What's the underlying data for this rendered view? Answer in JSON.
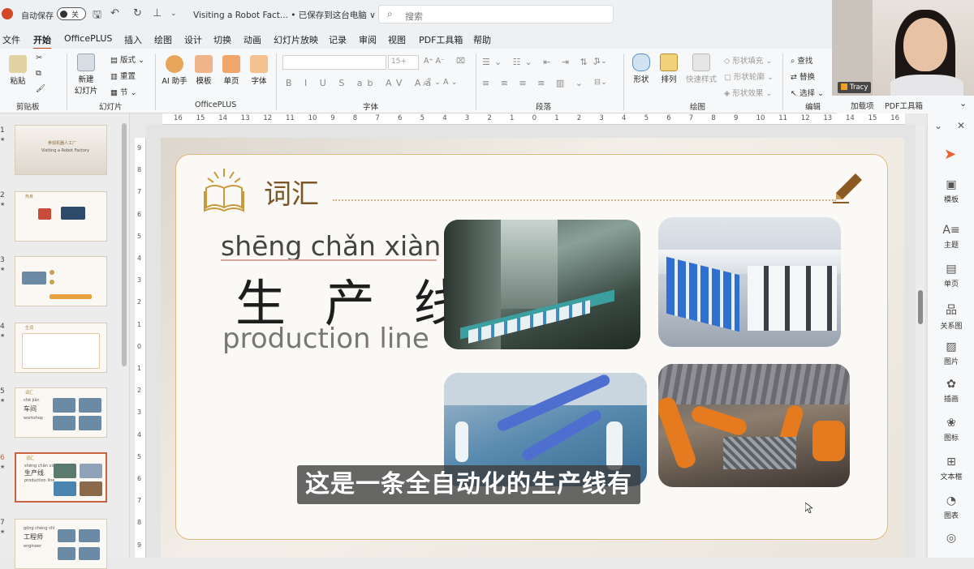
{
  "titlebar": {
    "autosave_label": "自动保存",
    "toggle_state": "关",
    "doc_title": "Visiting a Robot Fact... • 已保存到这台电脑 ∨",
    "search_placeholder": "搜索"
  },
  "menu": [
    "文件",
    "开始",
    "OfficePLUS",
    "插入",
    "绘图",
    "设计",
    "切换",
    "动画",
    "幻灯片放映",
    "记录",
    "审阅",
    "视图",
    "PDF工具箱",
    "帮助"
  ],
  "ribbon": {
    "paste": "粘贴",
    "new_slide": "新建\n幻灯片",
    "layout": "版式",
    "reset": "重置",
    "section": "节",
    "ai_helper": "AI 助手",
    "template": "模板",
    "single_page": "单页",
    "font": "字体",
    "font_size": "15+",
    "shape": "形状",
    "arrange": "排列",
    "quick_style": "快速样式",
    "shape_fill": "形状填充",
    "shape_outline": "形状轮廓",
    "shape_effect": "形状效果",
    "find": "查找",
    "replace": "替换",
    "select": "选择",
    "groups": {
      "clipboard": "剪贴板",
      "slides": "幻灯片",
      "officeplus": "OfficePLUS",
      "font": "字体",
      "paragraph": "段落",
      "drawing": "绘图",
      "editing": "编辑",
      "addins": "加载项",
      "pdf": "PDF工具箱"
    }
  },
  "webcam": {
    "name": "Tracy"
  },
  "thumbnails": [
    {
      "num": "1",
      "title": "参观机器人工厂",
      "sub": "Visiting a Robot Factory"
    },
    {
      "num": "2",
      "title": "热身"
    },
    {
      "num": "3",
      "title": ""
    },
    {
      "num": "4",
      "title": "生词"
    },
    {
      "num": "5",
      "title": "词汇",
      "pinyin": "chē jiān",
      "hanzi": "车间",
      "english": "workshop"
    },
    {
      "num": "6",
      "title": "词汇",
      "pinyin": "shēng chǎn xiàn",
      "hanzi": "生产线",
      "english": "production line"
    },
    {
      "num": "7",
      "title": "",
      "pinyin": "gōng chéng shī",
      "hanzi": "工程师",
      "english": "engineer"
    }
  ],
  "ruler": {
    "h": [
      "16",
      "15",
      "14",
      "13",
      "12",
      "11",
      "10",
      "9",
      "8",
      "7",
      "6",
      "5",
      "4",
      "3",
      "2",
      "1",
      "0",
      "1",
      "2",
      "3",
      "4",
      "5",
      "6",
      "7",
      "8",
      "9",
      "10",
      "11",
      "12",
      "13",
      "14",
      "15",
      "16"
    ],
    "v": [
      "9",
      "8",
      "7",
      "6",
      "5",
      "4",
      "3",
      "2",
      "1",
      "0",
      "1",
      "2",
      "3",
      "4",
      "5",
      "6",
      "7",
      "8",
      "9"
    ]
  },
  "slide": {
    "section_title": "词汇",
    "pinyin": "shēng chǎn xiàn",
    "hanzi": "生 产 线",
    "english": "production line"
  },
  "caption": "这是一条全自动化的生产线有",
  "side_panel": [
    "模板",
    "主题",
    "单页",
    "关系图",
    "图片",
    "插画",
    "图标",
    "文本框",
    "图表"
  ]
}
